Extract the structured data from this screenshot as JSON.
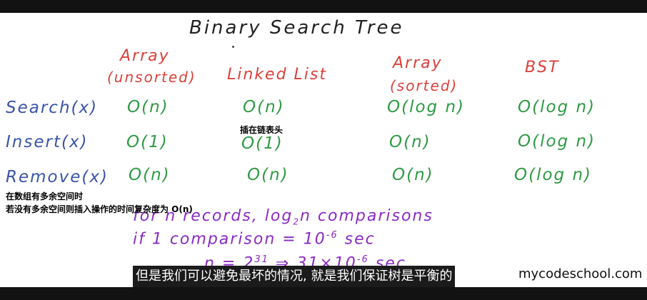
{
  "title": "Binary Search Tree",
  "columns": {
    "array_unsorted_1": "Array",
    "array_unsorted_2": "(unsorted)",
    "linked_list": "Linked List",
    "array_sorted_1": "Array",
    "array_sorted_2": "(sorted)",
    "bst": "BST"
  },
  "rows": {
    "search": "Search(x)",
    "insert": "Insert(x)",
    "remove": "Remove(x)"
  },
  "cells": {
    "search_array": "O(n)",
    "search_list": "O(n)",
    "search_sorted": "O(log n)",
    "search_bst": "O(log n)",
    "insert_array": "O(1)",
    "insert_list": "O(1)",
    "insert_sorted": "O(n)",
    "insert_bst": "O(log n)",
    "remove_array": "O(n)",
    "remove_list": "O(n)",
    "remove_sorted": "O(n)",
    "remove_bst": "O(log n)"
  },
  "annotations": {
    "linked_list_note": "插在链表头",
    "array_note_1": "在数组有多余空间时",
    "array_note_2": "若没有多余空间则插入操作的时间复杂度为 O(n)"
  },
  "bottom_notes": {
    "line1_a": "for n records, log",
    "line1_sub": "2",
    "line1_b": "n comparisons",
    "line2_a": "if 1 comparison = 10",
    "line2_sup": "-6",
    "line2_b": " sec",
    "line3_a": "n = 2",
    "line3_sup": "31",
    "line3_b": " ⇒ 31×10",
    "line3_sup2": "-6",
    "line3_c": " sec"
  },
  "subtitle": "但是我们可以避免最坏的情况, 就是我们保证树是平衡的",
  "watermark": "mycodeschool.com"
}
